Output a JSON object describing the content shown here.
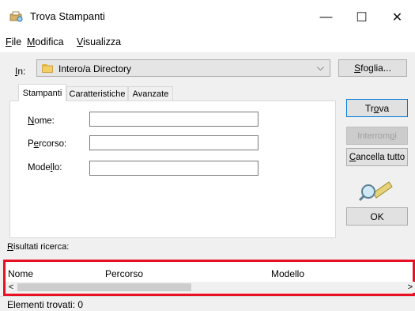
{
  "window": {
    "title": "Trova Stampanti",
    "minimize_glyph": "—",
    "maximize_glyph": "☐",
    "close_glyph": "✕",
    "icon": "printer-search-icon"
  },
  "menu": [
    {
      "label": "File",
      "mnemonic": "F",
      "rest": "ile"
    },
    {
      "label": "Modifica",
      "mnemonic": "M",
      "rest": "odifica"
    },
    {
      "label": "Visualizza",
      "mnemonic": "V",
      "rest": "isualizza"
    }
  ],
  "location": {
    "label": "In:",
    "label_mnemonic": "I",
    "label_rest": "n:",
    "value": "Intero/a Directory",
    "icon": "folder-icon"
  },
  "browse_button": {
    "label": "Sfoglia...",
    "mnemonic": "S",
    "rest": "foglia..."
  },
  "tabs": [
    {
      "label": "Stampanti",
      "selected": true
    },
    {
      "label": "Caratteristiche",
      "selected": false
    },
    {
      "label": "Avanzate",
      "selected": false
    }
  ],
  "fields": {
    "name": {
      "label": "Nome:",
      "mnemonic": "N",
      "rest": "ome:",
      "value": ""
    },
    "path": {
      "label": "Percorso:",
      "pre": "P",
      "mnemonic": "e",
      "rest": "rcorso:",
      "value": ""
    },
    "model": {
      "label": "Modello:",
      "pre": "Mode",
      "mnemonic": "l",
      "rest": "lo:",
      "value": ""
    }
  },
  "buttons": {
    "find": {
      "label": "Trova",
      "pre": "Tr",
      "mnemonic": "o",
      "rest": "va"
    },
    "stop": {
      "label": "Interrompi",
      "pre": "Interrom",
      "mnemonic": "p",
      "rest": "i",
      "disabled": true
    },
    "clear_all": {
      "label": "Cancella tutto",
      "mnemonic": "C",
      "rest": "ancella tutto"
    },
    "ok": {
      "label": "OK"
    }
  },
  "results": {
    "label": "Risultati ricerca:",
    "label_mnemonic": "R",
    "label_rest": "isultati ricerca:",
    "columns": [
      "Nome",
      "Percorso",
      "Modello"
    ],
    "rows": []
  },
  "status": {
    "text": "Elementi trovati: 0"
  },
  "colors": {
    "highlight_border": "#e81123",
    "focus_border": "#0078d7"
  }
}
